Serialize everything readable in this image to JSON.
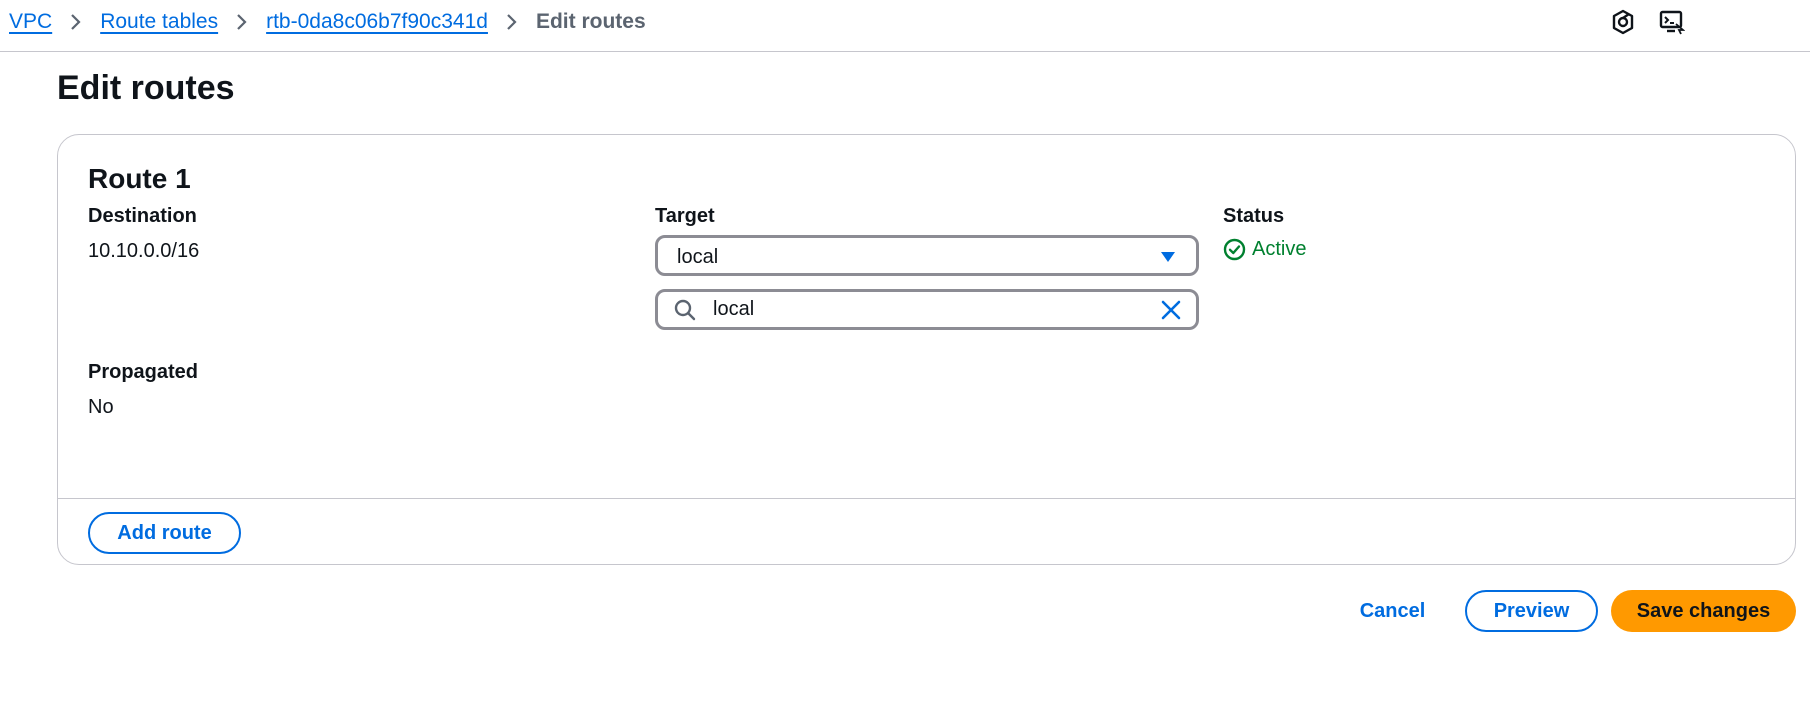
{
  "breadcrumb": {
    "items": [
      {
        "label": "VPC"
      },
      {
        "label": "Route tables"
      },
      {
        "label": "rtb-0da8c06b7f90c341d"
      }
    ],
    "current": "Edit routes"
  },
  "header": {
    "icons": [
      "settings-hexagon-icon",
      "cloudshell-icon"
    ]
  },
  "page": {
    "title": "Edit routes"
  },
  "route": {
    "title": "Route 1",
    "destination_label": "Destination",
    "destination_value": "10.10.0.0/16",
    "target_label": "Target",
    "target_selected": "local",
    "target_search_value": "local",
    "status_label": "Status",
    "status_value": "Active",
    "propagated_label": "Propagated",
    "propagated_value": "No"
  },
  "actions": {
    "add_route": "Add route",
    "cancel": "Cancel",
    "preview": "Preview",
    "save": "Save changes"
  },
  "colors": {
    "link": "#006ce0",
    "primary_button": "#ff9900",
    "status_success": "#00802f",
    "border": "#8c8c94"
  }
}
